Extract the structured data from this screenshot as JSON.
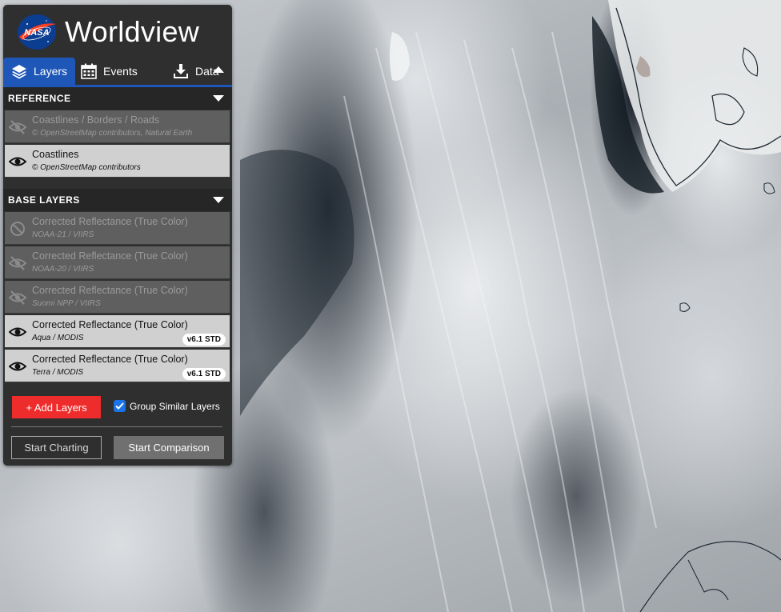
{
  "app": {
    "title": "Worldview",
    "logo_text": "NASA"
  },
  "tabs": [
    {
      "label": "Layers",
      "icon": "layers-icon",
      "active": true
    },
    {
      "label": "Events",
      "icon": "calendar-icon",
      "active": false
    },
    {
      "label": "Data",
      "icon": "download-icon",
      "active": false
    }
  ],
  "sections": {
    "reference": {
      "title": "REFERENCE",
      "layers": [
        {
          "name": "Coastlines / Borders / Roads",
          "source": "© OpenStreetMap contributors, Natural Earth",
          "visible": false,
          "icon": "eye-slash-icon"
        },
        {
          "name": "Coastlines",
          "source": "© OpenStreetMap contributors",
          "visible": true,
          "icon": "eye-icon"
        }
      ]
    },
    "base": {
      "title": "BASE LAYERS",
      "layers": [
        {
          "name": "Corrected Reflectance (True Color)",
          "source": "NOAA-21 / VIIRS",
          "visible": false,
          "icon": "ban-icon"
        },
        {
          "name": "Corrected Reflectance (True Color)",
          "source": "NOAA-20 / VIIRS",
          "visible": false,
          "icon": "eye-slash-icon"
        },
        {
          "name": "Corrected Reflectance (True Color)",
          "source": "Suomi NPP / VIIRS",
          "visible": false,
          "icon": "eye-slash-icon"
        },
        {
          "name": "Corrected Reflectance (True Color)",
          "source": "Aqua / MODIS",
          "visible": true,
          "icon": "eye-icon",
          "badge": "v6.1 STD"
        },
        {
          "name": "Corrected Reflectance (True Color)",
          "source": "Terra / MODIS",
          "visible": true,
          "icon": "eye-icon",
          "badge": "v6.1 STD"
        }
      ]
    }
  },
  "controls": {
    "add_layers": "+ Add Layers",
    "group_similar": "Group Similar Layers",
    "group_similar_checked": true,
    "start_charting": "Start Charting",
    "start_comparison": "Start Comparison"
  },
  "colors": {
    "accent": "#1e57b7",
    "add_button": "#ef2c2c",
    "panel": "#2f2f2f"
  }
}
